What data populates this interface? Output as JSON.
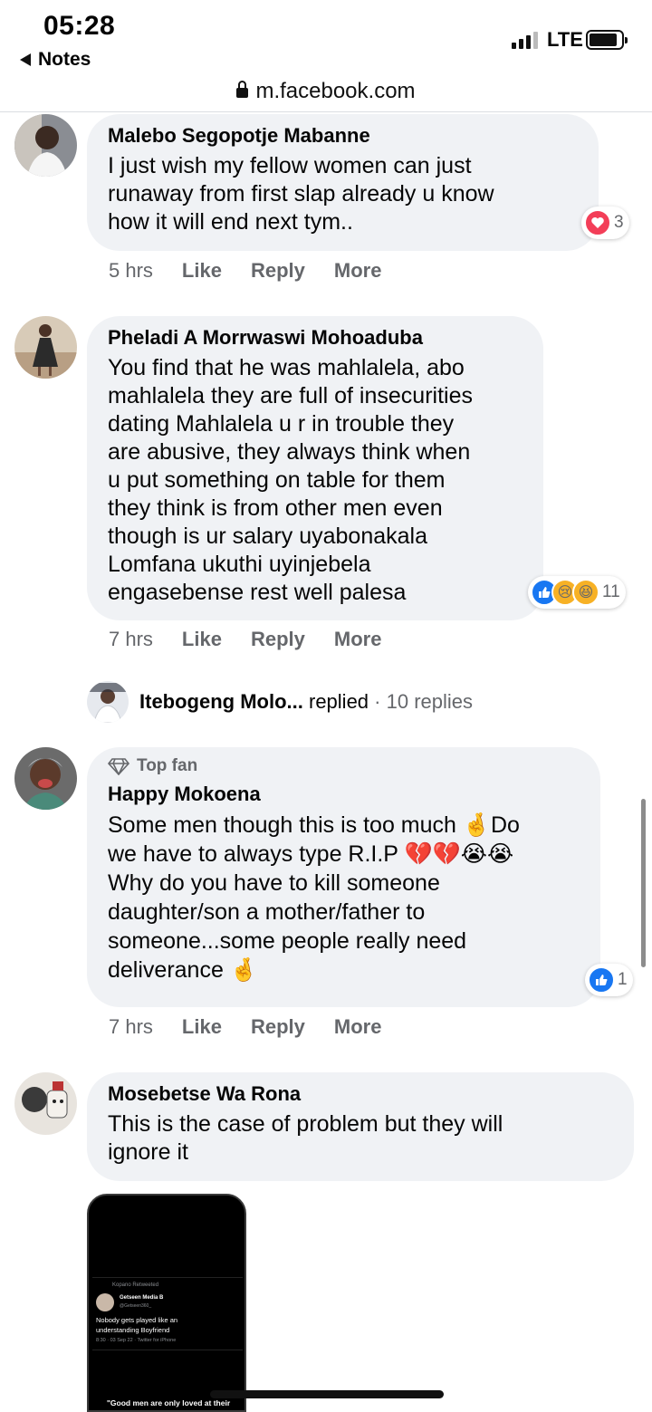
{
  "status": {
    "time": "05:28",
    "back_label": "Notes",
    "network": "LTE"
  },
  "browser": {
    "url": "m.facebook.com"
  },
  "comments": [
    {
      "author": "Malebo Segopotje Mabanne",
      "text": "I just wish my fellow women can just\nrunaway from first slap already u know\nhow it will end next tym..",
      "time": "5 hrs",
      "like": "Like",
      "reply": "Reply",
      "more": "More",
      "reaction_count": "3"
    },
    {
      "author": "Pheladi A Morrwaswi Mohoaduba",
      "text": "You find that he was mahlalela, abo\nmahlalela they are full of insecurities\ndating Mahlalela u r in trouble they\nare abusive, they always think when\nu put something on table for them\nthey think is from other men even\nthough is ur salary uyabonakala\nLomfana ukuthi uyinjebela\nengasebense rest well palesa",
      "time": "7 hrs",
      "like": "Like",
      "reply": "Reply",
      "more": "More",
      "reaction_count": "11",
      "replies": {
        "name": "Itebogeng Molo...",
        "verb": "replied",
        "count": "· 10 replies"
      }
    },
    {
      "badge": "Top fan",
      "author": "Happy Mokoena",
      "text": "Some men though this is too much 🤞Do\nwe have to always type R.I.P 💔💔😭😭\nWhy do you have to kill someone\ndaughter/son a mother/father to\nsomeone...some people really need\ndeliverance 🤞",
      "time": "7 hrs",
      "like": "Like",
      "reply": "Reply",
      "more": "More",
      "reaction_count": "1"
    },
    {
      "author": "Mosebetse Wa Rona",
      "text": "This is the case of problem but they will\nignore it"
    }
  ],
  "attachment": {
    "retweet": "Kopano Retweeted",
    "tweet_author": "Getseen Media B",
    "handle": "@Getseen360_",
    "tweet_text": "Nobody gets played like an understanding Boyfriend",
    "meta": "8:30 · 03 Sep 22 · Twitter for iPhone",
    "caption": "\"Good men are only loved at their funeral\" - unknown poet"
  },
  "colors": {
    "bubble": "#f0f2f5",
    "meta_gray": "#65676b",
    "like_blue": "#1877f2",
    "love_red": "#f33e58"
  }
}
